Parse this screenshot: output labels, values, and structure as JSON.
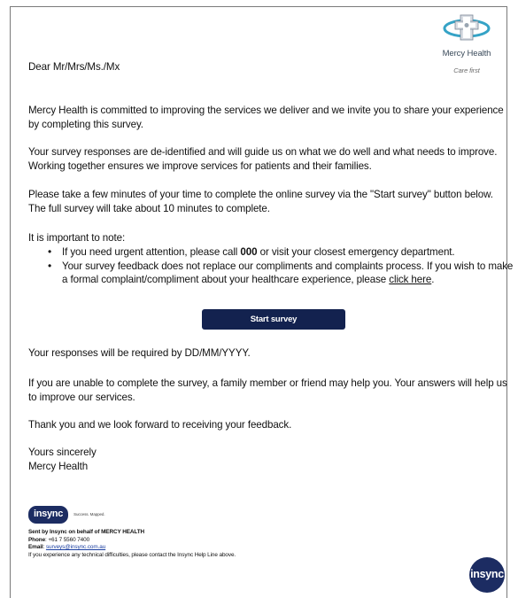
{
  "logo": {
    "brand": "Mercy Health",
    "tagline": "Care first"
  },
  "greeting": "Dear Mr/Mrs/Ms./Mx",
  "paragraphs": {
    "p1": "Mercy Health is committed to improving the services we deliver and we invite you to share your experience by completing this survey.",
    "p2": "Your survey responses are de-identified and will guide us on what we do well and what needs to improve. Working together ensures we improve services for patients and their families.",
    "p3": "Please take a few minutes of your time to complete the online survey via the \"Start survey\" button below. The full survey will take about 10 minutes to complete."
  },
  "note": {
    "intro": "It is important to note:",
    "bullet1_pre": "If you need urgent attention, please call ",
    "bullet1_num": "000",
    "bullet1_post": " or visit your closest emergency department.",
    "bullet2_pre": "Your survey feedback does not replace our compliments and complaints process. If you wish to make a formal complaint/compliment about your healthcare experience, please ",
    "bullet2_link": "click here",
    "bullet2_post": "."
  },
  "button": {
    "start_survey": "Start survey"
  },
  "after": {
    "deadline": "Your responses will be required by DD/MM/YYYY.",
    "family": "If you are unable to complete the survey, a family member or friend may help you. Your answers will help us to improve our services.",
    "thanks": "Thank you and we look forward to receiving your feedback.",
    "sign_off": "Yours sincerely",
    "signature": "Mercy Health"
  },
  "footer": {
    "insync_logo": "insync",
    "insync_tagline": "Success. Mapped.",
    "sent_by": "Sent by Insync on behalf of MERCY HEALTH",
    "phone_label": "Phone",
    "phone": ": +61 7 5560 7400",
    "email_label": "Email",
    "email_sep": ": ",
    "email": "surveys@insync.com.au",
    "help": "If you experience any technical difficulties, please contact the Insync Help Line above.",
    "insync_circle": "insync"
  }
}
